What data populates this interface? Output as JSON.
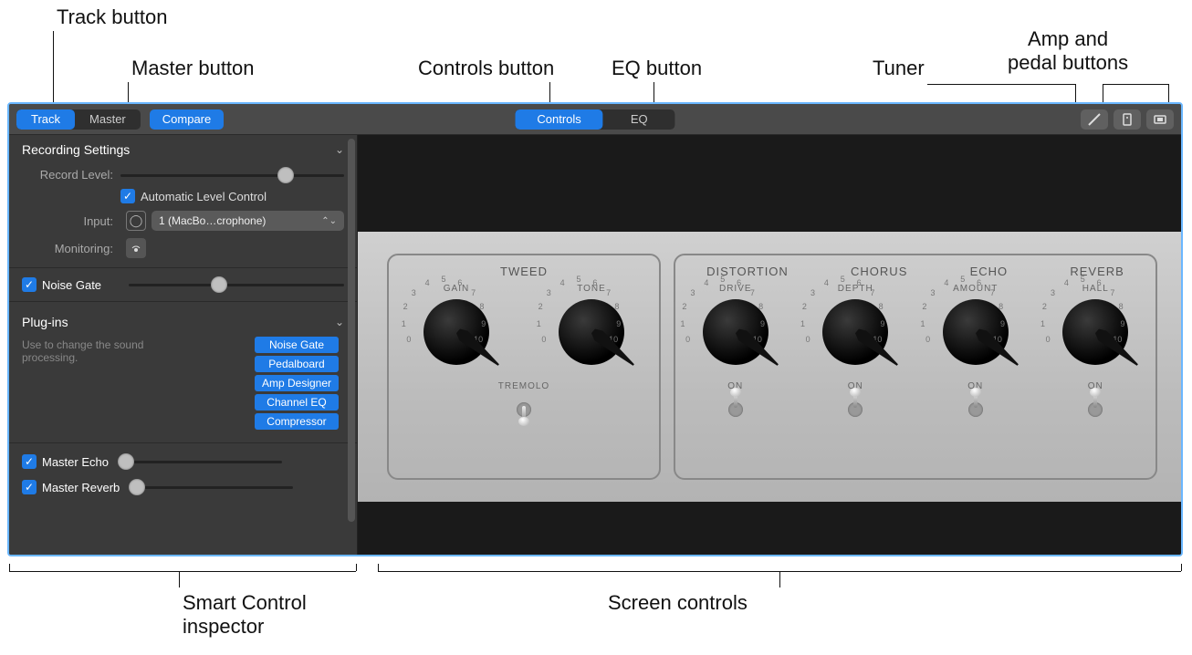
{
  "callouts": {
    "track": "Track button",
    "master": "Master button",
    "controls": "Controls button",
    "eq": "EQ button",
    "tuner": "Tuner",
    "amp": "Amp and\npedal buttons",
    "inspector": "Smart Control\ninspector",
    "screen": "Screen controls"
  },
  "toolbar": {
    "track": "Track",
    "master": "Master",
    "compare": "Compare",
    "controls": "Controls",
    "eq": "EQ"
  },
  "inspector": {
    "recording_hd": "Recording Settings",
    "record_level": "Record Level:",
    "auto_level": "Automatic Level Control",
    "input_lbl": "Input:",
    "input_val": "1 (MacBo…crophone)",
    "monitoring": "Monitoring:",
    "noise_gate": "Noise Gate",
    "plugins_hd": "Plug-ins",
    "plugins_desc": "Use to change the sound processing.",
    "plugins": [
      "Noise Gate",
      "Pedalboard",
      "Amp Designer",
      "Channel EQ",
      "Compressor"
    ],
    "master_echo": "Master Echo",
    "master_reverb": "Master Reverb"
  },
  "amp": {
    "tweed": {
      "title": "TWEED",
      "k1": "GAIN",
      "k2": "TONE",
      "sw": "TREMOLO"
    },
    "fx": {
      "titles": [
        "DISTORTION",
        "CHORUS",
        "ECHO",
        "REVERB"
      ],
      "labels": [
        "DRIVE",
        "DEPTH",
        "AMOUNT",
        "HALL"
      ],
      "sw": "ON"
    },
    "ticks": [
      "0",
      "1",
      "2",
      "3",
      "4",
      "5",
      "6",
      "7",
      "8",
      "9",
      "10"
    ]
  }
}
